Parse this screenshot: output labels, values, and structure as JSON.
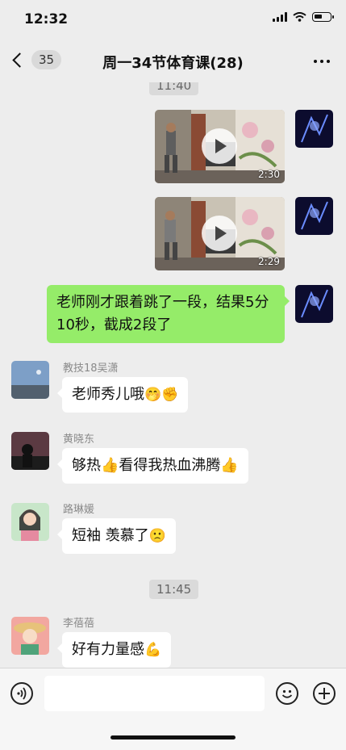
{
  "status": {
    "time": "12:32"
  },
  "nav": {
    "unread": "35",
    "title": "周一34节体育课(28)"
  },
  "timestamps": [
    "11:40",
    "11:45"
  ],
  "videos": [
    {
      "duration": "2:30"
    },
    {
      "duration": "2:29"
    }
  ],
  "messages": [
    {
      "sender": "",
      "text": "老师刚才跟着跳了一段，结果5分10秒，截成2段了",
      "outgoing": true
    },
    {
      "sender": "教技18吴潇",
      "text": "老师秀儿哦",
      "emoji": "🤭✊",
      "outgoing": false
    },
    {
      "sender": "黄晓东",
      "text": "够热👍看得我热血沸腾👍",
      "outgoing": false
    },
    {
      "sender": "路琳媛",
      "text": "短袖 羡慕了",
      "emoji": "🙁",
      "outgoing": false
    },
    {
      "sender": "李蓓蓓",
      "text": "好有力量感",
      "emoji": "💪",
      "outgoing": false
    }
  ],
  "input": {
    "value": ""
  },
  "colors": {
    "background": "#ededed",
    "outgoing_bubble": "#95ec69",
    "incoming_bubble": "#ffffff"
  }
}
